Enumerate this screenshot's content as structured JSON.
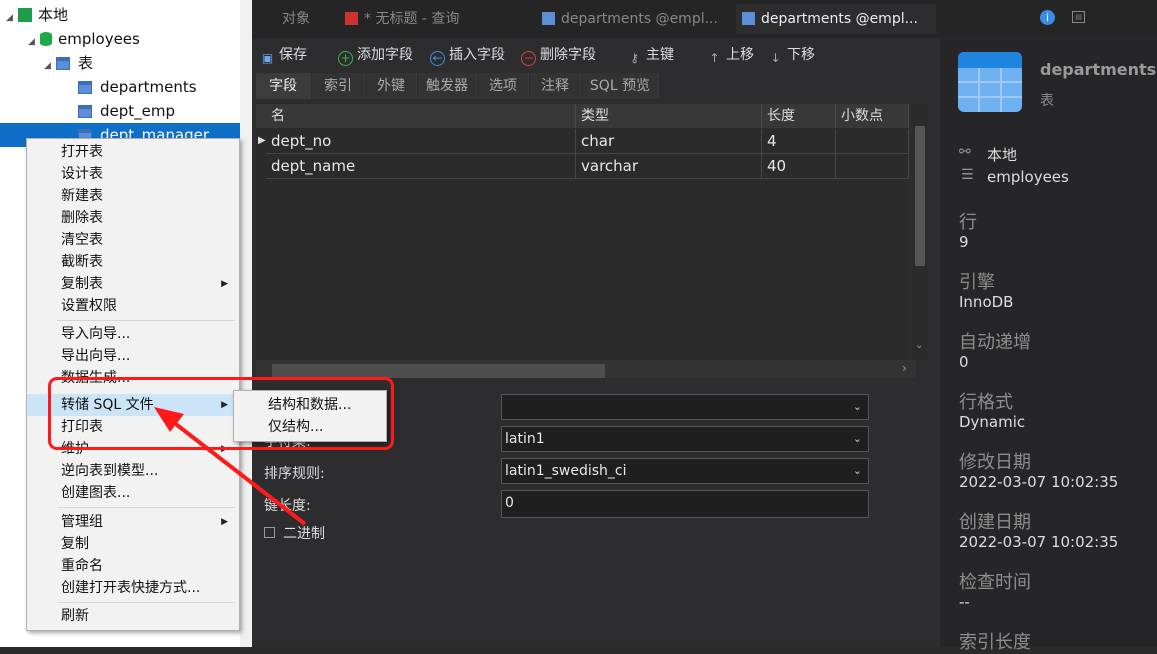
{
  "tree": {
    "connection": "本地",
    "database": "employees",
    "tables_folder": "表",
    "tables": [
      "departments",
      "dept_emp",
      "dept_manager"
    ]
  },
  "tabs": [
    "对象",
    "* 无标题 - 查询",
    "departments @empl...",
    "departments @empl..."
  ],
  "toolbar": {
    "save": "保存",
    "add_field": "添加字段",
    "insert_field": "插入字段",
    "delete_field": "删除字段",
    "primary_key": "主键",
    "move_up": "上移",
    "move_down": "下移"
  },
  "subtabs": [
    "字段",
    "索引",
    "外键",
    "触发器",
    "选项",
    "注释",
    "SQL 预览"
  ],
  "grid": {
    "columns": [
      "名",
      "类型",
      "长度",
      "小数点"
    ],
    "rows": [
      [
        "dept_no",
        "char",
        "4",
        ""
      ],
      [
        "dept_name",
        "varchar",
        "40",
        ""
      ]
    ]
  },
  "options": {
    "charset_label": "字符集:",
    "charset": "latin1",
    "collation_label": "排序规则:",
    "collation": "latin1_swedish_ci",
    "key_length_label": "键长度:",
    "key_length": "0",
    "binary_label": "二进制"
  },
  "context_menu": {
    "groups": [
      [
        "打开表",
        "设计表",
        "新建表",
        "删除表",
        "清空表",
        "截断表",
        "复制表",
        "设置权限"
      ],
      [
        "导入向导...",
        "导出向导...",
        "数据生成...",
        "转储 SQL 文件",
        "打印表",
        "维护",
        "逆向表到模型...",
        "创建图表..."
      ],
      [
        "管理组",
        "复制",
        "重命名",
        "创建打开表快捷方式..."
      ],
      [
        "刷新"
      ]
    ],
    "submenu": [
      "结构和数据...",
      "仅结构..."
    ]
  },
  "info": {
    "name": "departments",
    "kind": "表",
    "connection": "本地",
    "database": "employees",
    "rows_label": "行",
    "rows": "9",
    "engine_label": "引擎",
    "engine": "InnoDB",
    "auto_inc_label": "自动递增",
    "auto_inc": "0",
    "row_format_label": "行格式",
    "row_format": "Dynamic",
    "modified_label": "修改日期",
    "modified": "2022-03-07 10:02:35",
    "created_label": "创建日期",
    "created": "2022-03-07 10:02:35",
    "check_time_label": "检查时间",
    "check_time": "--",
    "index_len_label": "索引长度"
  },
  "colors": {
    "selection": "#0f6ec8",
    "highlight_box": "#ff1a1a",
    "menu_highlight": "#cce4f7"
  }
}
